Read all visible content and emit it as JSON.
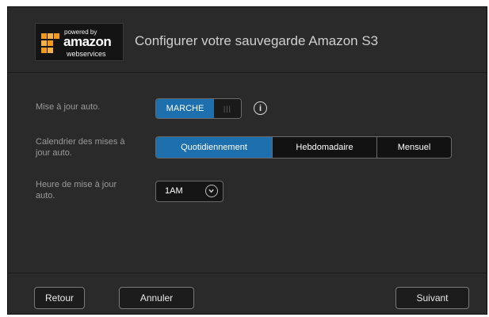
{
  "header": {
    "logo": {
      "powered_by": "powered by",
      "brand": "amazon",
      "sub": "webservices"
    },
    "title": "Configurer votre sauvegarde Amazon S3"
  },
  "settings": {
    "auto_update": {
      "label": "Mise à jour auto.",
      "toggle_state": "MARCHE",
      "toggle_grip": "|||",
      "info_icon": "info-icon"
    },
    "schedule": {
      "label_line1": "Calendrier des mises à",
      "label_line2": "jour auto.",
      "options": [
        "Quotidiennement",
        "Hebdomadaire",
        "Mensuel"
      ],
      "selected": "Quotidiennement"
    },
    "time": {
      "label_line1": "Heure de mise à jour",
      "label_line2": "auto.",
      "value": "1AM"
    }
  },
  "footer": {
    "back": "Retour",
    "cancel": "Annuler",
    "next": "Suivant"
  },
  "colors": {
    "accent": "#1e6fad",
    "panel": "#2a2a2a",
    "logo_orange": "#f39a1e"
  }
}
